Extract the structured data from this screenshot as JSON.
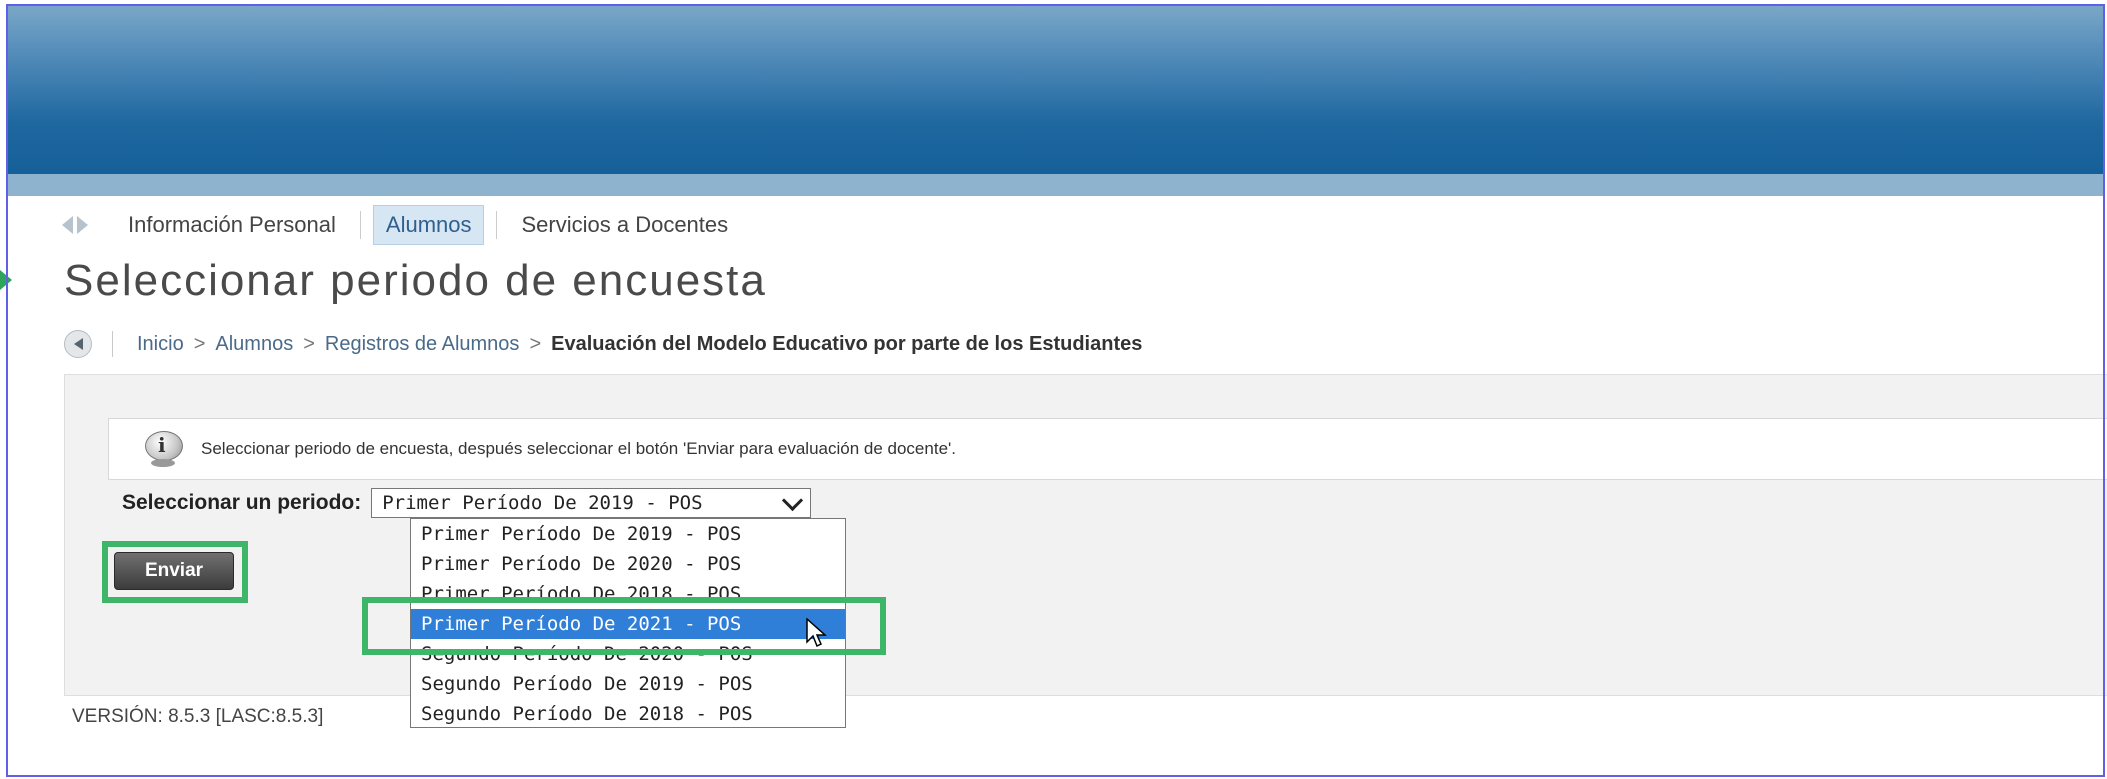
{
  "tabs": [
    {
      "label": "Información Personal"
    },
    {
      "label": "Alumnos"
    },
    {
      "label": "Servicios a Docentes"
    }
  ],
  "page": {
    "title": "Seleccionar periodo de encuesta"
  },
  "breadcrumb": [
    {
      "label": "Inicio"
    },
    {
      "label": "Alumnos"
    },
    {
      "label": "Registros de Alumnos"
    },
    {
      "label": "Evaluación del Modelo Educativo por parte de los Estudiantes"
    }
  ],
  "breadcrumb_separator": ">",
  "info": {
    "message": "Seleccionar periodo de encuesta, después seleccionar el botón 'Enviar para evaluación de docente'."
  },
  "period_select": {
    "label": "Seleccionar un periodo:",
    "current_value": "Primer Período De 2019 - POS",
    "options": [
      "Primer Período De 2019 - POS",
      "Primer Período De 2020 - POS",
      "Primer Período De 2018 - POS",
      "Primer Período De 2021 - POS",
      "Segundo Período De 2020 - POS",
      "Segundo Período De 2019 - POS",
      "Segundo Período De 2018 - POS"
    ],
    "highlighted_option": "Primer Período De 2021 - POS"
  },
  "submit": {
    "label": "Enviar"
  },
  "footer": {
    "version": "VERSIÓN: 8.5.3 [LASC:8.5.3]"
  },
  "colors": {
    "highlight": "#3fb56a",
    "banner": "#1e679f",
    "selected_option": "#2f7fd8"
  }
}
